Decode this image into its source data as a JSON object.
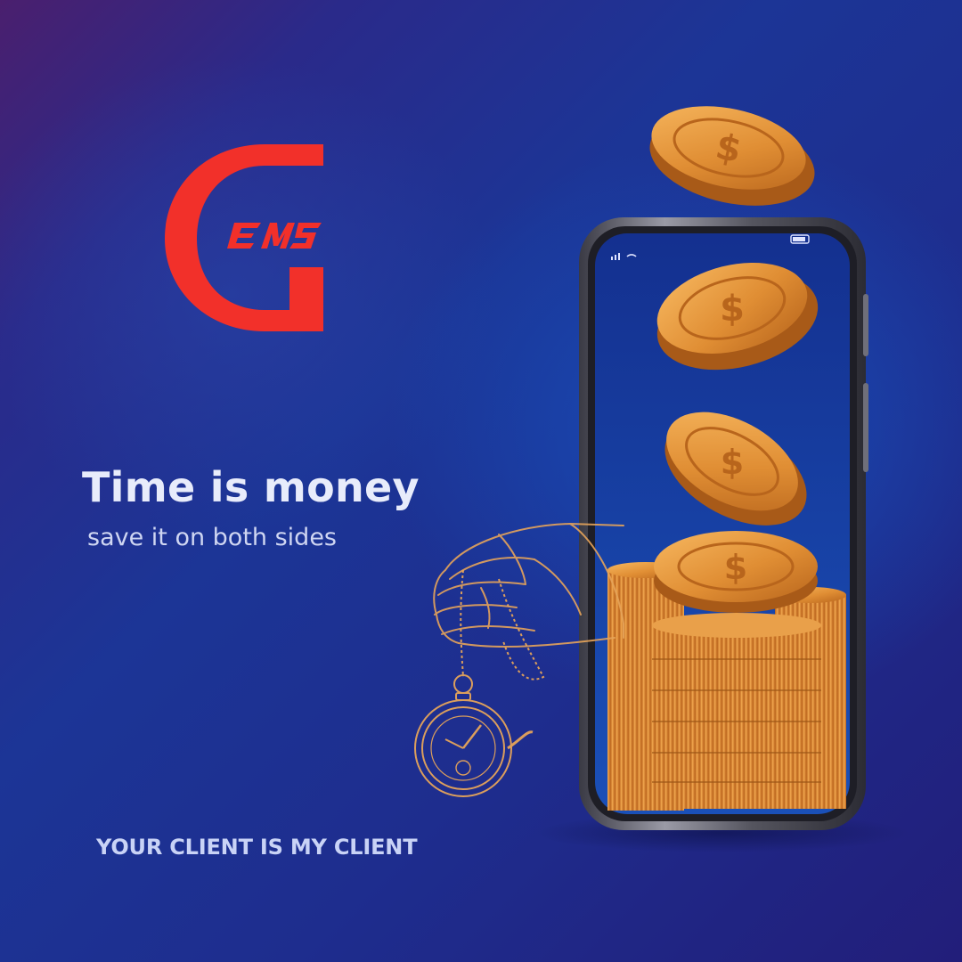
{
  "brand": {
    "logo_text": "GEMS",
    "logo_color": "#f2302a"
  },
  "headline": "Time is money",
  "subheadline": "save it on both sides",
  "tagline": "YOUR CLIENT IS MY CLIENT",
  "colors": {
    "background_dark": "#221e7a",
    "background_mid": "#1c3596",
    "coin_gold": "#e59a3c",
    "text_light": "#e8ecfb"
  },
  "illustration": {
    "elements": [
      "smartphone",
      "falling-coins",
      "coin-stacks",
      "hand-sketch",
      "pocket-watch"
    ]
  }
}
